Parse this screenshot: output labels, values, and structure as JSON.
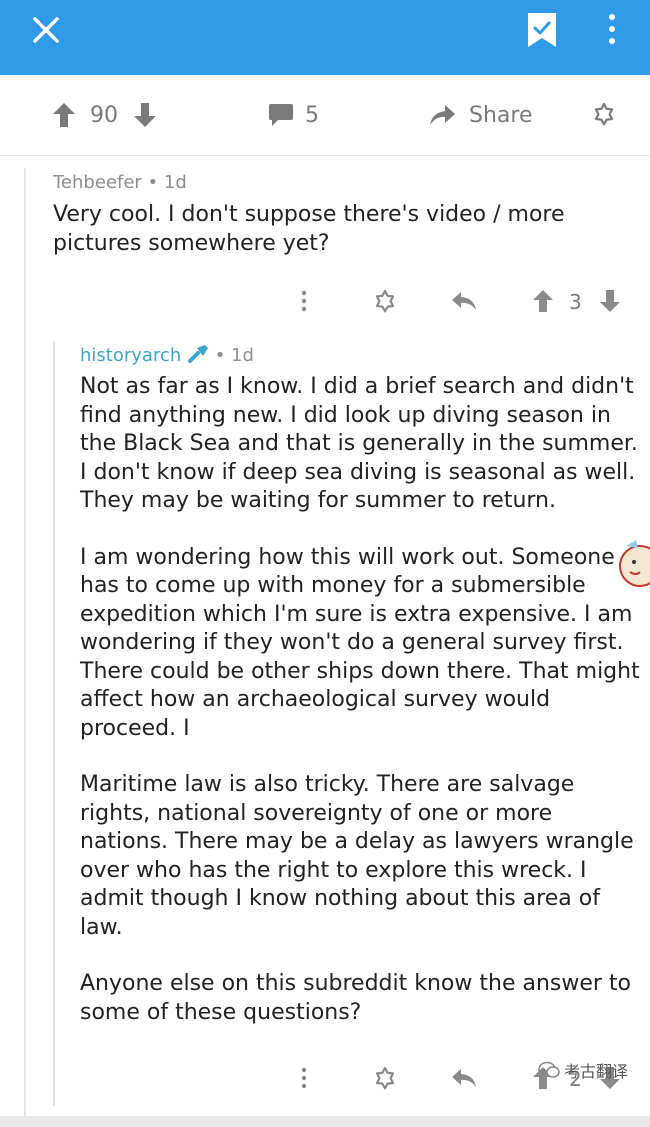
{
  "topbar": {
    "close_icon": "close-icon",
    "bookmark_icon": "bookmark-check-icon",
    "more_icon": "more-vertical-icon",
    "color": "#2f9be8"
  },
  "actions": {
    "score": "90",
    "comments": "5",
    "share_label": "Share"
  },
  "comments": [
    {
      "author": "Tehbeefer",
      "age": "• 1d",
      "body": "Very cool.  I don't suppose there's video / more pictures somewhere yet?",
      "score": "3"
    },
    {
      "author": "historyarch",
      "age": "• 1d",
      "paragraphs": [
        "Not as far as I know.  I did a brief search and didn't find anything new.  I did look up diving season in the Black Sea and that is generally in the summer.  I don't know if deep sea diving is seasonal as well.  They may be waiting for summer to return.",
        "I am wondering how this will work out.  Someone has to come up with money for a submersible expedition which I'm sure is extra expensive.  I am wondering if they won't do a general survey first.  There could be other ships down there.  That might affect how an archaeological survey would proceed.  I",
        "Maritime law is also tricky.  There are salvage rights, national sovereignty of one or more nations.  There may be a delay as lawyers wrangle over who has the right to explore this wreck.  I admit though I know nothing about this area of law.",
        "Anyone else on this subreddit know the answer to some of these questions?"
      ],
      "score": "2"
    }
  ],
  "watermark": "考古翻译"
}
